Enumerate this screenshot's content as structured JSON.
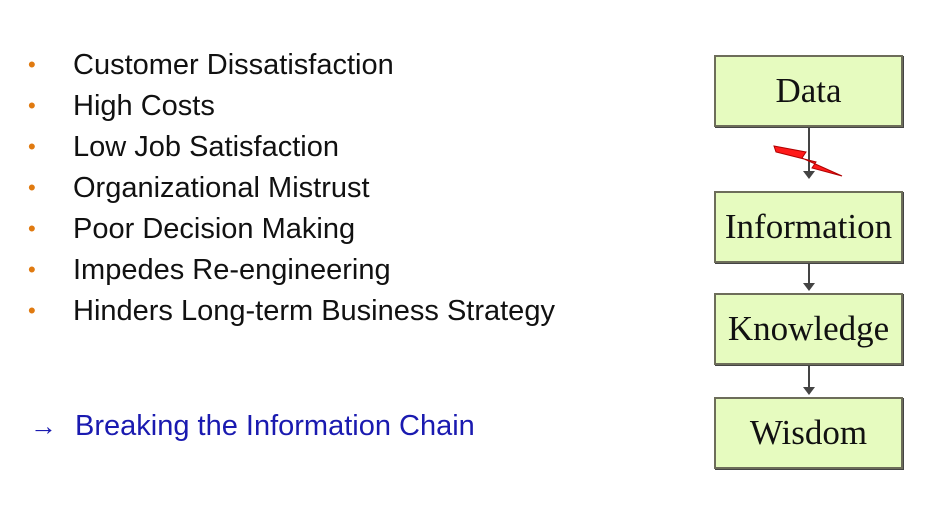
{
  "colors": {
    "bullet": "#e07a10",
    "callout": "#1a1ab0",
    "box_fill": "#e6fbbf",
    "bolt": "#ff1a1a"
  },
  "bullets": [
    {
      "text": "Customer Dissatisfaction"
    },
    {
      "text": "High Costs"
    },
    {
      "text": "Low Job Satisfaction"
    },
    {
      "text": "Organizational Mistrust"
    },
    {
      "text": "Poor Decision Making"
    },
    {
      "text": "Impedes Re-engineering"
    },
    {
      "text": "Hinders Long-term Business Strategy"
    }
  ],
  "callout": {
    "arrow": "→",
    "text": "Breaking the Information Chain"
  },
  "chain": {
    "nodes": [
      "Data",
      "Information",
      "Knowledge",
      "Wisdom"
    ],
    "broken_link_icon": "lightning-bolt-icon"
  }
}
